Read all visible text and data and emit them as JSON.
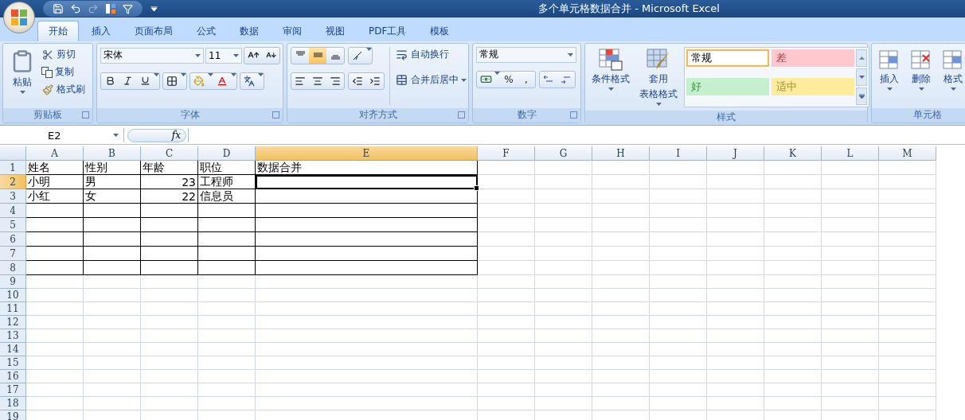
{
  "window": {
    "title": "多个单元格数据合并 - Microsoft Excel"
  },
  "tabs": [
    {
      "label": "开始",
      "selected": true
    },
    {
      "label": "插入",
      "selected": false
    },
    {
      "label": "页面布局",
      "selected": false
    },
    {
      "label": "公式",
      "selected": false
    },
    {
      "label": "数据",
      "selected": false
    },
    {
      "label": "审阅",
      "selected": false
    },
    {
      "label": "视图",
      "selected": false
    },
    {
      "label": "PDF工具",
      "selected": false
    },
    {
      "label": "模板",
      "selected": false
    }
  ],
  "clipboard": {
    "label": "剪贴板",
    "paste": "粘贴",
    "cut": "剪切",
    "copy": "复制",
    "format_painter": "格式刷"
  },
  "font": {
    "label": "字体",
    "name": "宋体",
    "size": "11"
  },
  "alignment": {
    "label": "对齐方式",
    "wrap_text": "自动换行",
    "merge_center": "合并后居中",
    "vertical": [
      {
        "selected": false
      },
      {
        "selected": true
      },
      {
        "selected": false
      }
    ]
  },
  "number": {
    "label": "数字",
    "format": "常规",
    "percent": "%",
    "comma": ","
  },
  "styles": {
    "label": "样式",
    "conditional_format": "条件格式",
    "table_format": [
      "套用",
      "表格格式"
    ],
    "cells": [
      {
        "label": "常规",
        "color": "#ffffff",
        "selected": true
      },
      {
        "label": "差",
        "color": "#ffc7ce",
        "selected": false
      },
      {
        "label": "好",
        "color": "#c6efce",
        "selected": false
      },
      {
        "label": "适中",
        "color": "#ffeb9c",
        "selected": false
      }
    ]
  },
  "cells_group": {
    "label": "单元格",
    "insert": "插入",
    "delete": "删除",
    "format": "格式"
  },
  "formula_bar": {
    "name_box": "E2",
    "fx": "fx"
  },
  "grid": {
    "columns": [
      {
        "label": "A",
        "selected": false,
        "bordered": true
      },
      {
        "label": "B",
        "selected": false,
        "bordered": true
      },
      {
        "label": "C",
        "selected": false,
        "bordered": true
      },
      {
        "label": "D",
        "selected": false,
        "bordered": true
      },
      {
        "label": "E",
        "selected": true,
        "bordered": true
      },
      {
        "label": "F",
        "selected": false,
        "bordered": false
      },
      {
        "label": "G",
        "selected": false,
        "bordered": false
      },
      {
        "label": "H",
        "selected": false,
        "bordered": false
      },
      {
        "label": "I",
        "selected": false,
        "bordered": false
      },
      {
        "label": "J",
        "selected": false,
        "bordered": false
      },
      {
        "label": "K",
        "selected": false,
        "bordered": false
      },
      {
        "label": "L",
        "selected": false,
        "bordered": false
      },
      {
        "label": "M",
        "selected": false,
        "bordered": false
      }
    ],
    "rows": [
      {
        "label": "1",
        "selected": false,
        "bordered": true,
        "cells": [
          {
            "value": "姓名",
            "kind": "text"
          },
          {
            "value": "性别",
            "kind": "text"
          },
          {
            "value": "年龄",
            "kind": "text"
          },
          {
            "value": "职位",
            "kind": "text"
          },
          {
            "value": "数据合并",
            "kind": "text"
          }
        ]
      },
      {
        "label": "2",
        "selected": true,
        "bordered": true,
        "cells": [
          {
            "value": "小明",
            "kind": "text"
          },
          {
            "value": "男",
            "kind": "text"
          },
          {
            "value": "23",
            "kind": "number"
          },
          {
            "value": "工程师",
            "kind": "text"
          }
        ]
      },
      {
        "label": "3",
        "selected": false,
        "bordered": true,
        "cells": [
          {
            "value": "小红",
            "kind": "text"
          },
          {
            "value": "女",
            "kind": "text"
          },
          {
            "value": "22",
            "kind": "number"
          },
          {
            "value": "信息员",
            "kind": "text"
          }
        ]
      },
      {
        "label": "4",
        "selected": false,
        "bordered": true
      },
      {
        "label": "5",
        "selected": false,
        "bordered": true
      },
      {
        "label": "6",
        "selected": false,
        "bordered": true
      },
      {
        "label": "7",
        "selected": false,
        "bordered": true
      },
      {
        "label": "8",
        "selected": false,
        "bordered": true
      },
      {
        "label": "9",
        "selected": false,
        "bordered": false
      },
      {
        "label": "10",
        "selected": false,
        "bordered": false
      },
      {
        "label": "11",
        "selected": false,
        "bordered": false
      },
      {
        "label": "12",
        "selected": false,
        "bordered": false
      },
      {
        "label": "13",
        "selected": false,
        "bordered": false
      },
      {
        "label": "14",
        "selected": false,
        "bordered": false
      },
      {
        "label": "15",
        "selected": false,
        "bordered": false
      },
      {
        "label": "16",
        "selected": false,
        "bordered": false
      },
      {
        "label": "17",
        "selected": false,
        "bordered": false
      },
      {
        "label": "18",
        "selected": false,
        "bordered": false
      },
      {
        "label": "19",
        "selected": false,
        "bordered": false
      }
    ]
  }
}
